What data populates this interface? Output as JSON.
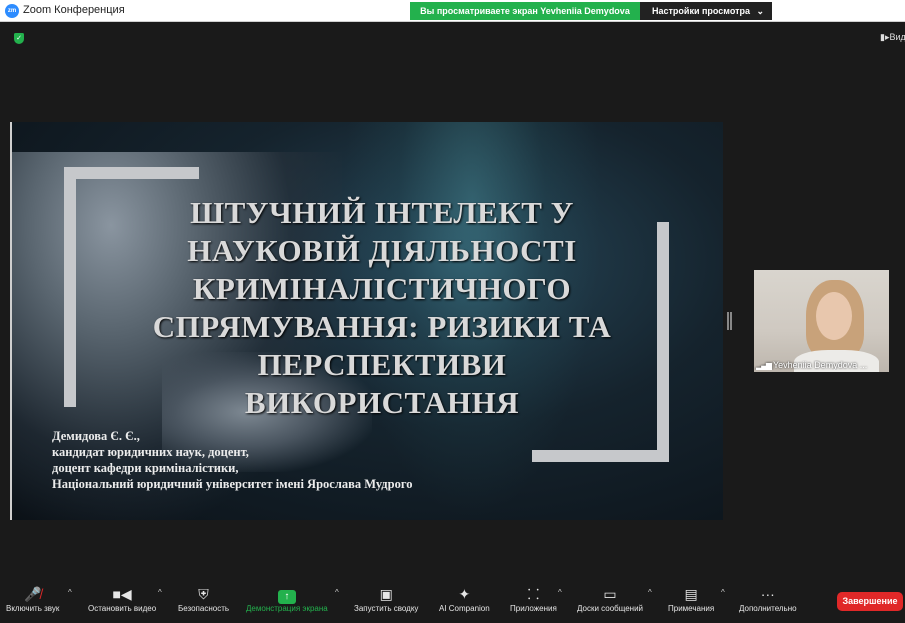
{
  "titlebar": {
    "app_title": "Zoom Конференция",
    "share_banner": "Вы просматриваете экран Yevheniia Demydova",
    "view_options": "Настройки просмотра"
  },
  "top_controls": {
    "view_label": "Вид"
  },
  "slide": {
    "title_lines": [
      "ШТУЧНИЙ ІНТЕЛЕКТ У",
      "НАУКОВІЙ ДІЯЛЬНОСТІ",
      "КРИМІНАЛІСТИЧНОГО",
      "СПРЯМУВАННЯ: РИЗИКИ ТА",
      "ПЕРСПЕКТИВИ",
      "ВИКОРИСТАННЯ"
    ],
    "author_lines": [
      "Демидова Є. Є.,",
      "кандидат юридичних наук, доцент,",
      "доцент кафедри криміналістики,",
      "Національний юридичний університет імені Ярослава Мудрого"
    ]
  },
  "participant": {
    "name": "Yevheniia Demydova",
    "name_suffix": " ..."
  },
  "toolbar": {
    "audio": "Включить звук",
    "video": "Остановить видео",
    "security": "Безопасность",
    "share": "Демонстрация экрана",
    "summary": "Запустить сводку",
    "companion": "AI Companion",
    "apps": "Приложения",
    "whiteboards": "Доски сообщений",
    "notes": "Примечания",
    "more": "Дополнительно",
    "end": "Завершение"
  },
  "colors": {
    "share_green": "#23b14d",
    "end_red": "#e02828",
    "brand_blue": "#2d8cff"
  },
  "icons": {
    "audio": "muted-microphone-icon",
    "video": "video-camera-icon",
    "security": "shield-icon",
    "share": "share-screen-icon",
    "summary": "summary-icon",
    "companion": "sparkle-icon",
    "apps": "apps-icon",
    "whiteboards": "whiteboard-icon",
    "notes": "notes-icon",
    "more": "more-dots-icon"
  }
}
